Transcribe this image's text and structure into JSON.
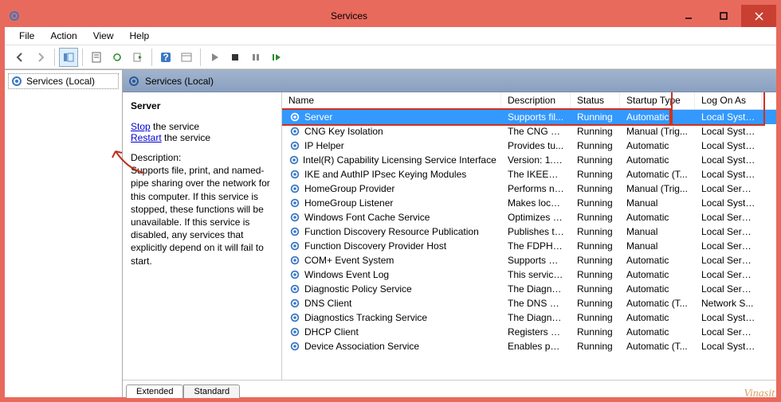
{
  "window": {
    "title": "Services"
  },
  "menu": {
    "file": "File",
    "action": "Action",
    "view": "View",
    "help": "Help"
  },
  "tree": {
    "root": "Services (Local)"
  },
  "panel": {
    "heading": "Services (Local)"
  },
  "detail": {
    "title": "Server",
    "stop_link": "Stop",
    "stop_suffix": " the service",
    "restart_link": "Restart",
    "restart_suffix": " the service",
    "desc_label": "Description:",
    "desc_text": "Supports file, print, and named-pipe sharing over the network for this computer. If this service is stopped, these functions will be unavailable. If this service is disabled, any services that explicitly depend on it will fail to start."
  },
  "columns": {
    "name": "Name",
    "desc": "Description",
    "status": "Status",
    "startup": "Startup Type",
    "logon": "Log On As"
  },
  "rows": [
    {
      "name": "Server",
      "desc": "Supports fil...",
      "status": "Running",
      "startup": "Automatic",
      "logon": "Local Syste...",
      "selected": true
    },
    {
      "name": "CNG Key Isolation",
      "desc": "The CNG ke...",
      "status": "Running",
      "startup": "Manual (Trig...",
      "logon": "Local Syste..."
    },
    {
      "name": "IP Helper",
      "desc": "Provides tu...",
      "status": "Running",
      "startup": "Automatic",
      "logon": "Local Syste..."
    },
    {
      "name": "Intel(R) Capability Licensing Service Interface",
      "desc": "Version: 1.2...",
      "status": "Running",
      "startup": "Automatic",
      "logon": "Local Syste..."
    },
    {
      "name": "IKE and AuthIP IPsec Keying Modules",
      "desc": "The IKEEXT ...",
      "status": "Running",
      "startup": "Automatic (T...",
      "logon": "Local Syste..."
    },
    {
      "name": "HomeGroup Provider",
      "desc": "Performs ne...",
      "status": "Running",
      "startup": "Manual (Trig...",
      "logon": "Local Service"
    },
    {
      "name": "HomeGroup Listener",
      "desc": "Makes local...",
      "status": "Running",
      "startup": "Manual",
      "logon": "Local Syste..."
    },
    {
      "name": "Windows Font Cache Service",
      "desc": "Optimizes p...",
      "status": "Running",
      "startup": "Automatic",
      "logon": "Local Service"
    },
    {
      "name": "Function Discovery Resource Publication",
      "desc": "Publishes th...",
      "status": "Running",
      "startup": "Manual",
      "logon": "Local Service"
    },
    {
      "name": "Function Discovery Provider Host",
      "desc": "The FDPHO...",
      "status": "Running",
      "startup": "Manual",
      "logon": "Local Service"
    },
    {
      "name": "COM+ Event System",
      "desc": "Supports Sy...",
      "status": "Running",
      "startup": "Automatic",
      "logon": "Local Service"
    },
    {
      "name": "Windows Event Log",
      "desc": "This service ...",
      "status": "Running",
      "startup": "Automatic",
      "logon": "Local Service"
    },
    {
      "name": "Diagnostic Policy Service",
      "desc": "The Diagno...",
      "status": "Running",
      "startup": "Automatic",
      "logon": "Local Service"
    },
    {
      "name": "DNS Client",
      "desc": "The DNS Cli...",
      "status": "Running",
      "startup": "Automatic (T...",
      "logon": "Network S..."
    },
    {
      "name": "Diagnostics Tracking Service",
      "desc": "The Diagno...",
      "status": "Running",
      "startup": "Automatic",
      "logon": "Local Syste..."
    },
    {
      "name": "DHCP Client",
      "desc": "Registers an...",
      "status": "Running",
      "startup": "Automatic",
      "logon": "Local Service"
    },
    {
      "name": "Device Association Service",
      "desc": "Enables pair...",
      "status": "Running",
      "startup": "Automatic (T...",
      "logon": "Local Syste..."
    }
  ],
  "tabs": {
    "extended": "Extended",
    "standard": "Standard"
  },
  "watermark": "Vinasit"
}
